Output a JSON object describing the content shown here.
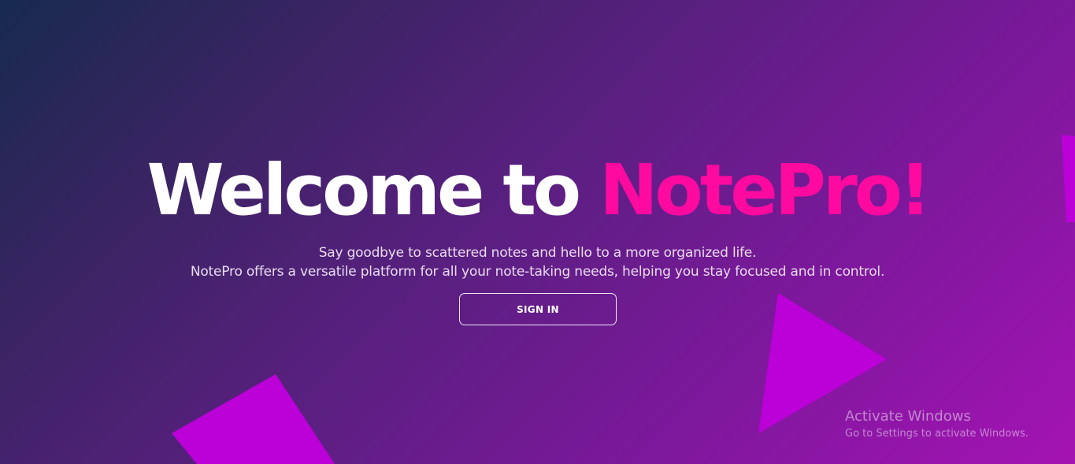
{
  "hero": {
    "title_prefix": "Welcome to ",
    "title_brand": "NotePro!",
    "tagline_line1": "Say goodbye to scattered notes and hello to a more organized life.",
    "tagline_line2": "NotePro offers a versatile platform for all your note-taking needs, helping you stay focused and in control.",
    "signin_label": "SIGN IN"
  },
  "watermark": {
    "title": "Activate Windows",
    "subtitle": "Go to Settings to activate Windows."
  },
  "colors": {
    "brand_accent": "#ff0aa0",
    "shape_fill": "#bb00d8",
    "background_start": "#172a4e",
    "background_end": "#a413b3"
  }
}
